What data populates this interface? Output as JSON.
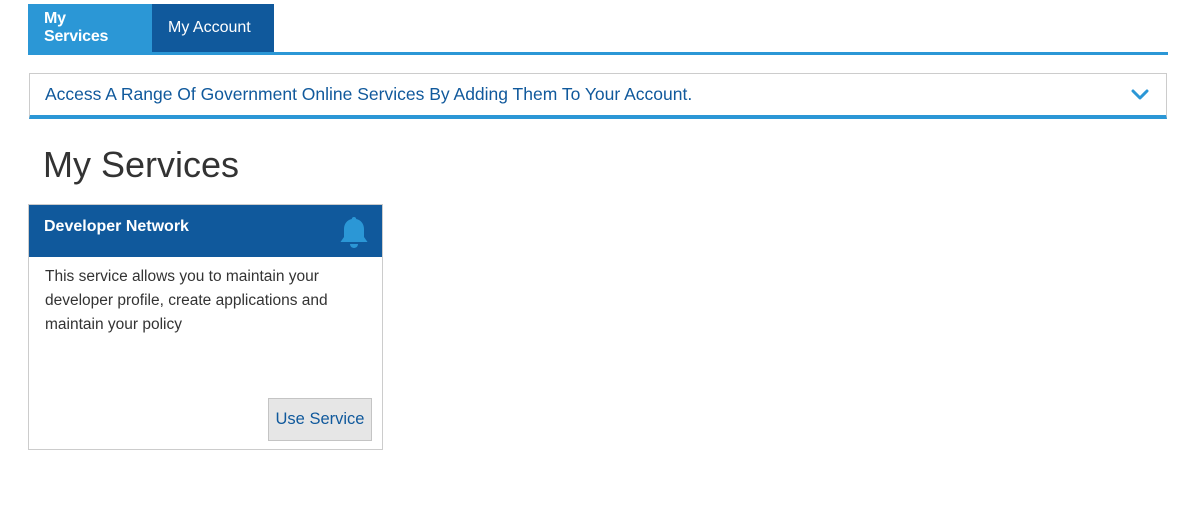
{
  "tabs": [
    {
      "label": "My Services",
      "active": true
    },
    {
      "label": "My Account",
      "active": false
    }
  ],
  "banner": {
    "text": "Access A Range Of Government Online Services By Adding Them To Your Account.",
    "icon": "chevron-down-icon"
  },
  "page": {
    "title": "My Services"
  },
  "service_card": {
    "title": "Developer Network",
    "icon": "bell-icon",
    "description": "This service allows you to maintain your developer profile, create applications and maintain your policy",
    "button_label": "Use Service"
  },
  "colors": {
    "accent": "#2b97d6",
    "brand_dark": "#10599c",
    "text": "#333333",
    "button_bg": "#e6e6e6"
  }
}
